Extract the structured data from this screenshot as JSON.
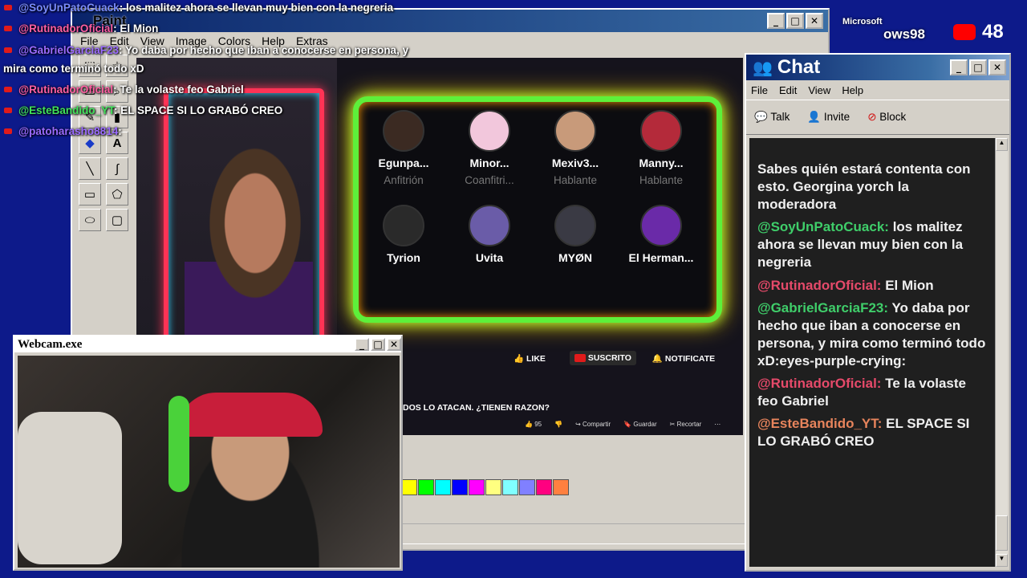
{
  "overlay_chat": [
    {
      "user": "@SoyUnPatoCuack",
      "text": ": los malitez ahora se llevan muy bien con la negreria",
      "color": "#7a8cff"
    },
    {
      "user": "@RutinadorOficial",
      "text": ": El Mion",
      "color": "#ff5fa2"
    },
    {
      "user": "@GabrielGarciaF23",
      "text": ": Yo daba por hecho que iban a conocerse en persona, y",
      "color": "#9b6bff"
    },
    {
      "user": "",
      "text": "mira como terminó todo xD",
      "color": "#ffffff"
    },
    {
      "user": "@RutinadorOficial",
      "text": ": Te la volaste feo Gabriel",
      "color": "#ff5fa2"
    },
    {
      "user": "@EsteBandido_YT",
      "text": ": EL SPACE SI LO GRABÓ CREO",
      "color": "#41e25a"
    },
    {
      "user": "@patoharasho8814",
      "text": ":",
      "color": "#9b6bff"
    }
  ],
  "paint": {
    "title": "Paint",
    "menu": [
      "File",
      "Edit",
      "View",
      "Image",
      "Colors",
      "Help",
      "Extras"
    ]
  },
  "stream": {
    "speakers": [
      {
        "name": "Egunpa...",
        "role": "Anfitrión",
        "color": "#3b2a22"
      },
      {
        "name": "Minor...",
        "role": "Coanfitri...",
        "color": "#f2c7dc"
      },
      {
        "name": "Mexiv3...",
        "role": "Hablante",
        "color": "#c89a7a"
      },
      {
        "name": "Manny...",
        "role": "Hablante",
        "color": "#b42a3a"
      },
      {
        "name": "Tyrion",
        "role": "",
        "color": "#2a2a2a"
      },
      {
        "name": "Uvita",
        "role": "",
        "color": "#6a5ca8"
      },
      {
        "name": "MYØN",
        "role": "",
        "color": "#3a3a44"
      },
      {
        "name": "El Herman...",
        "role": "",
        "color": "#6a2aa8"
      }
    ],
    "like": "LIKE",
    "subscribed": "SUSCRITO",
    "notify": "NOTIFICATE",
    "video_title": "DOS LO ATACAN. ¿TIENEN RAZON?",
    "likes": "95",
    "share": "Compartir",
    "save": "Guardar",
    "clip": "Recortar"
  },
  "webcam": {
    "title": "Webcam.exe"
  },
  "taskbar": {
    "brand_top": "Microsoft",
    "brand": "ows98",
    "viewers": "48"
  },
  "chat_window": {
    "title": "Chat",
    "menu": [
      "File",
      "Edit",
      "View",
      "Help"
    ],
    "toolbar": [
      "Talk",
      "Invite",
      "Block"
    ],
    "intro": "Sabes quién estará contenta con esto. Georgina yorch la moderadora",
    "messages": [
      {
        "user": "@SoyUnPatoCuack:",
        "text": "los malitez ahora se llevan muy bien con la negreria",
        "cls": "n"
      },
      {
        "user": "@RutinadorOficial:",
        "text": "El Mion",
        "cls": "r"
      },
      {
        "user": "@GabrielGarciaF23:",
        "text": "Yo daba por hecho que iban a conocerse en persona, y mira como terminó todo xD:eyes-purple-crying:",
        "cls": "n"
      },
      {
        "user": "@RutinadorOficial:",
        "text": "Te la volaste feo Gabriel",
        "cls": "r"
      },
      {
        "user": "@EsteBandido_YT:",
        "text": "EL SPACE SI LO GRABÓ CREO",
        "cls": "p"
      }
    ]
  },
  "palette": [
    "#ffff00",
    "#00ff00",
    "#00ffff",
    "#0000ff",
    "#ff00ff",
    "#ffff80",
    "#80ffff",
    "#8080ff",
    "#ff0080",
    "#ff8040"
  ]
}
